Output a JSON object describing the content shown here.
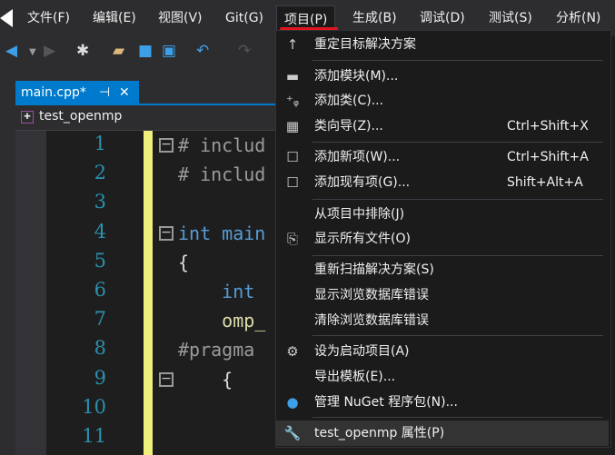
{
  "menubar": {
    "items": [
      "文件(F)",
      "编辑(E)",
      "视图(V)",
      "Git(G)",
      "项目(P)",
      "生成(B)",
      "调试(D)",
      "测试(S)",
      "分析(N)"
    ],
    "active": "项目(P)"
  },
  "tab": {
    "title": "main.cpp*",
    "pin": "⊣",
    "close": "✕"
  },
  "nav": {
    "project": "test_openmp"
  },
  "editor": {
    "line_numbers": [
      "1",
      "2",
      "3",
      "4",
      "5",
      "6",
      "7",
      "8",
      "9",
      "10",
      "11"
    ],
    "lines": [
      "# includ",
      "# includ",
      "",
      "int main",
      "{",
      "    int",
      "    omp_",
      "#pragma",
      "    {",
      "",
      ""
    ]
  },
  "menu": {
    "items": [
      {
        "icon": "arrow-up-icon",
        "label": "重定目标解决方案",
        "shortcut": ""
      },
      {
        "icon": "add-module-icon",
        "label": "添加模块(M)...",
        "shortcut": ""
      },
      {
        "icon": "add-class-icon",
        "label": "添加类(C)...",
        "shortcut": ""
      },
      {
        "icon": "class-wizard-icon",
        "label": "类向导(Z)...",
        "shortcut": "Ctrl+Shift+X"
      },
      {
        "icon": "new-item-icon",
        "label": "添加新项(W)...",
        "shortcut": "Ctrl+Shift+A"
      },
      {
        "icon": "existing-item-icon",
        "label": "添加现有项(G)...",
        "shortcut": "Shift+Alt+A"
      },
      {
        "icon": "",
        "label": "从项目中排除(J)",
        "shortcut": ""
      },
      {
        "icon": "show-files-icon",
        "label": "显示所有文件(O)",
        "shortcut": ""
      },
      {
        "icon": "",
        "label": "重新扫描解决方案(S)",
        "shortcut": ""
      },
      {
        "icon": "",
        "label": "显示浏览数据库错误",
        "shortcut": ""
      },
      {
        "icon": "",
        "label": "清除浏览数据库错误",
        "shortcut": ""
      },
      {
        "icon": "gear-icon",
        "label": "设为启动项目(A)",
        "shortcut": ""
      },
      {
        "icon": "",
        "label": "导出模板(E)...",
        "shortcut": ""
      },
      {
        "icon": "nuget-icon",
        "label": "管理 NuGet 程序包(N)...",
        "shortcut": ""
      },
      {
        "icon": "wrench-icon",
        "label": "test_openmp 属性(P)",
        "shortcut": ""
      }
    ]
  },
  "colors": {
    "accent": "#007acc",
    "annotation": "#e0161e"
  }
}
